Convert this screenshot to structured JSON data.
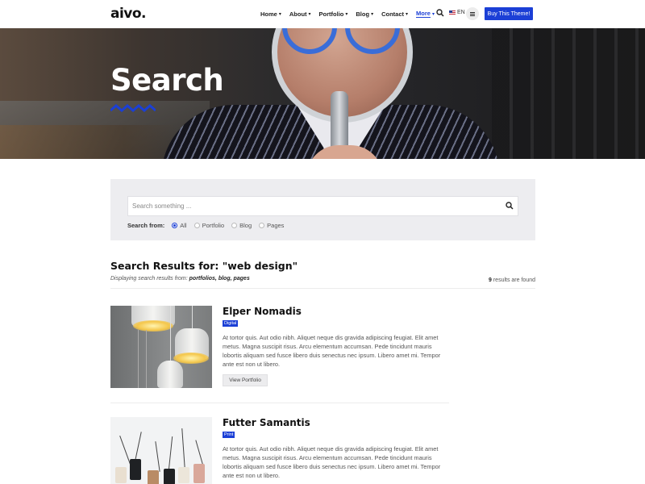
{
  "header": {
    "logo": "aivo.",
    "nav": [
      {
        "label": "Home",
        "active": false
      },
      {
        "label": "About",
        "active": false
      },
      {
        "label": "Portfolio",
        "active": false
      },
      {
        "label": "Blog",
        "active": false
      },
      {
        "label": "Contact",
        "active": false
      },
      {
        "label": "More",
        "active": true
      }
    ],
    "language": "EN",
    "buy_label": "Buy This Theme!",
    "accent_color": "#1b3fd6"
  },
  "hero": {
    "title": "Search"
  },
  "search": {
    "placeholder": "Search something ...",
    "value": "",
    "from_label": "Search from:",
    "options": [
      {
        "label": "All",
        "checked": true
      },
      {
        "label": "Portfolio",
        "checked": false
      },
      {
        "label": "Blog",
        "checked": false
      },
      {
        "label": "Pages",
        "checked": false
      }
    ]
  },
  "results": {
    "title": "Search Results for: \"web design\"",
    "sub_prefix": "Displaying search results from: ",
    "sub_sources": "portfolios, blog, pages",
    "count": "9",
    "count_suffix": " results are found",
    "items": [
      {
        "title": "Elper Nomadis",
        "tag": "Digital",
        "text": "At tortor quis. Aut odio nibh. Aliquet neque dis gravida adipiscing feugiat. Elit amet metus. Magna suscipit risus. Arcu elementum accumsan. Pede tincidunt mauris lobortis aliquam sed fusce libero duis senectus nec ipsum. Libero amet mi. Tempor ante est non ut libero.",
        "button": "View Portfolio"
      },
      {
        "title": "Futter Samantis",
        "tag": "Print",
        "text": "At tortor quis. Aut odio nibh. Aliquet neque dis gravida adipiscing feugiat. Elit amet metus. Magna suscipit risus. Arcu elementum accumsan. Pede tincidunt mauris lobortis aliquam sed fusce libero duis senectus nec ipsum. Libero amet mi. Tempor ante est non ut libero."
      }
    ]
  }
}
